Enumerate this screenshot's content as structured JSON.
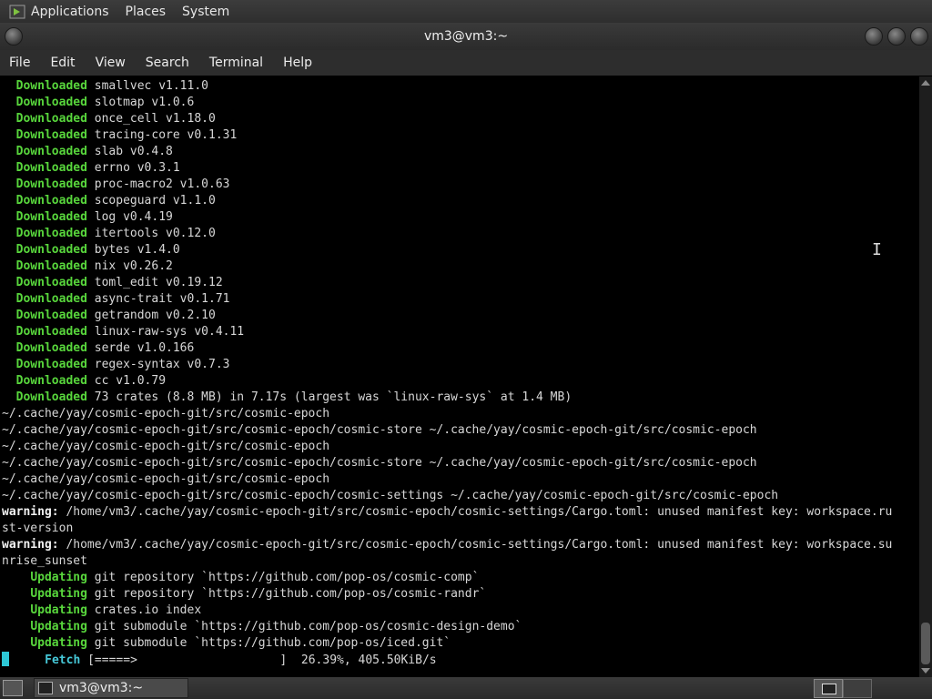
{
  "top_panel": {
    "menus": [
      "Applications",
      "Places",
      "System"
    ]
  },
  "window": {
    "title": "vm3@vm3:~"
  },
  "menubar": {
    "items": [
      "File",
      "Edit",
      "View",
      "Search",
      "Terminal",
      "Help"
    ]
  },
  "terminal": {
    "lines": [
      {
        "status": "Downloaded",
        "text": " smallvec v1.11.0",
        "indent": "  "
      },
      {
        "status": "Downloaded",
        "text": " slotmap v1.0.6",
        "indent": "  "
      },
      {
        "status": "Downloaded",
        "text": " once_cell v1.18.0",
        "indent": "  "
      },
      {
        "status": "Downloaded",
        "text": " tracing-core v0.1.31",
        "indent": "  "
      },
      {
        "status": "Downloaded",
        "text": " slab v0.4.8",
        "indent": "  "
      },
      {
        "status": "Downloaded",
        "text": " errno v0.3.1",
        "indent": "  "
      },
      {
        "status": "Downloaded",
        "text": " proc-macro2 v1.0.63",
        "indent": "  "
      },
      {
        "status": "Downloaded",
        "text": " scopeguard v1.1.0",
        "indent": "  "
      },
      {
        "status": "Downloaded",
        "text": " log v0.4.19",
        "indent": "  "
      },
      {
        "status": "Downloaded",
        "text": " itertools v0.12.0",
        "indent": "  "
      },
      {
        "status": "Downloaded",
        "text": " bytes v1.4.0",
        "indent": "  "
      },
      {
        "status": "Downloaded",
        "text": " nix v0.26.2",
        "indent": "  "
      },
      {
        "status": "Downloaded",
        "text": " toml_edit v0.19.12",
        "indent": "  "
      },
      {
        "status": "Downloaded",
        "text": " async-trait v0.1.71",
        "indent": "  "
      },
      {
        "status": "Downloaded",
        "text": " getrandom v0.2.10",
        "indent": "  "
      },
      {
        "status": "Downloaded",
        "text": " linux-raw-sys v0.4.11",
        "indent": "  "
      },
      {
        "status": "Downloaded",
        "text": " serde v1.0.166",
        "indent": "  "
      },
      {
        "status": "Downloaded",
        "text": " regex-syntax v0.7.3",
        "indent": "  "
      },
      {
        "status": "Downloaded",
        "text": " cc v1.0.79",
        "indent": "  "
      },
      {
        "status": "Downloaded",
        "text": " 73 crates (8.8 MB) in 7.17s (largest was `linux-raw-sys` at 1.4 MB)",
        "indent": "  "
      },
      {
        "status": "",
        "text": "~/.cache/yay/cosmic-epoch-git/src/cosmic-epoch",
        "indent": ""
      },
      {
        "status": "",
        "text": "~/.cache/yay/cosmic-epoch-git/src/cosmic-epoch/cosmic-store ~/.cache/yay/cosmic-epoch-git/src/cosmic-epoch",
        "indent": ""
      },
      {
        "status": "",
        "text": "~/.cache/yay/cosmic-epoch-git/src/cosmic-epoch",
        "indent": ""
      },
      {
        "status": "",
        "text": "~/.cache/yay/cosmic-epoch-git/src/cosmic-epoch/cosmic-store ~/.cache/yay/cosmic-epoch-git/src/cosmic-epoch",
        "indent": ""
      },
      {
        "status": "",
        "text": "~/.cache/yay/cosmic-epoch-git/src/cosmic-epoch",
        "indent": ""
      },
      {
        "status": "",
        "text": "~/.cache/yay/cosmic-epoch-git/src/cosmic-epoch/cosmic-settings ~/.cache/yay/cosmic-epoch-git/src/cosmic-epoch",
        "indent": ""
      },
      {
        "warn": "warning:",
        "text": " /home/vm3/.cache/yay/cosmic-epoch-git/src/cosmic-epoch/cosmic-settings/Cargo.toml: unused manifest key: workspace.ru",
        "indent": ""
      },
      {
        "status": "",
        "text": "st-version",
        "indent": ""
      },
      {
        "warn": "warning:",
        "text": " /home/vm3/.cache/yay/cosmic-epoch-git/src/cosmic-epoch/cosmic-settings/Cargo.toml: unused manifest key: workspace.su",
        "indent": ""
      },
      {
        "status": "",
        "text": "nrise_sunset",
        "indent": ""
      },
      {
        "status": "Updating",
        "text": " git repository `https://github.com/pop-os/cosmic-comp`",
        "indent": "    "
      },
      {
        "status": "Updating",
        "text": " git repository `https://github.com/pop-os/cosmic-randr`",
        "indent": "    "
      },
      {
        "status": "Updating",
        "text": " crates.io index",
        "indent": "    "
      },
      {
        "status": "Updating",
        "text": " git submodule `https://github.com/pop-os/cosmic-design-demo`",
        "indent": "    "
      },
      {
        "status": "Updating",
        "text": " git submodule `https://github.com/pop-os/iced.git`",
        "indent": "    "
      },
      {
        "fetch": "Fetch",
        "text": " [=====>                    ]  26.39%, 405.50KiB/s",
        "indent": "      "
      }
    ]
  },
  "taskbar": {
    "task_label": "vm3@vm3:~"
  },
  "colors": {
    "status_green": "#58d63c",
    "fetch_cyan": "#46c8d8",
    "terminal_bg": "#000000",
    "terminal_fg": "#d7d7d7"
  }
}
